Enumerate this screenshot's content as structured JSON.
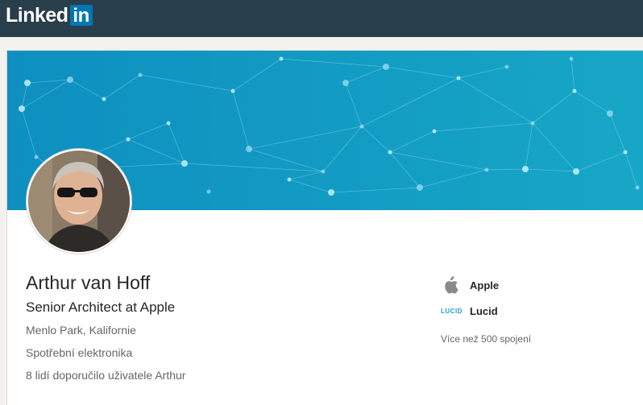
{
  "header": {
    "logo_text": "Linked",
    "logo_in": "in",
    "background_color": "#283e4a",
    "accent_color": "#0077b5"
  },
  "banner": {
    "gradient_colors": [
      "#0e8fc0",
      "#17a7c6"
    ]
  },
  "profile": {
    "name": "Arthur van Hoff",
    "headline": "Senior Architect at Apple",
    "location": "Menlo Park, Kalifornie",
    "industry": "Spotřební elektronika",
    "recommendations": "8 lidí doporučilo uživatele Arthur",
    "avatar_icon": "profile-photo"
  },
  "sidebar": {
    "items": [
      {
        "label": "Apple",
        "icon": "apple-icon"
      },
      {
        "label": "Lucid",
        "icon": "lucid-logo",
        "icon_text": "LUCID"
      }
    ],
    "connections": "Více než 500 spojení"
  }
}
